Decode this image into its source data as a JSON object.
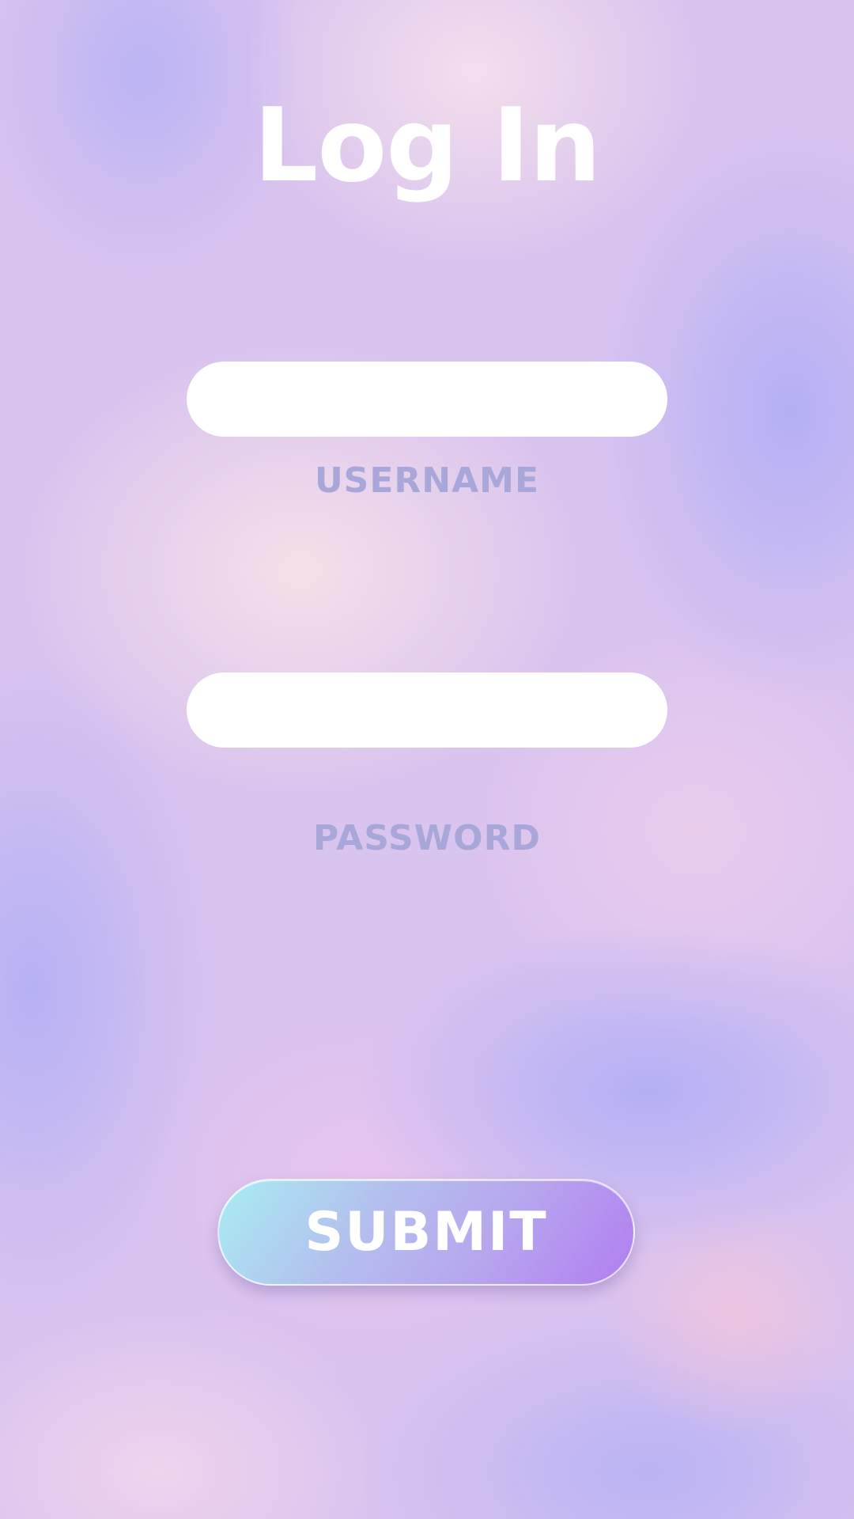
{
  "page": {
    "title": "Log In"
  },
  "form": {
    "username": {
      "label": "USERNAME",
      "value": "",
      "placeholder": ""
    },
    "password": {
      "label": "PASSWORD",
      "value": "",
      "placeholder": ""
    },
    "submit_label": "SUBMIT"
  },
  "colors": {
    "title_text": "#ffffff",
    "label_text": "#a9a7d9",
    "field_background": "#ffffff",
    "button_gradient_start": "#a8eef2",
    "button_gradient_end": "#b07ef0",
    "button_text": "#ffffff"
  }
}
